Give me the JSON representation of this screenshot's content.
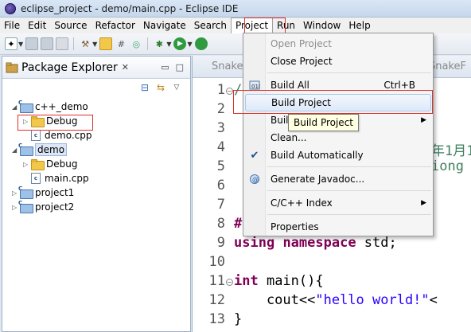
{
  "window": {
    "title": "eclipse_project - demo/main.cpp - Eclipse IDE"
  },
  "menubar": [
    "File",
    "Edit",
    "Source",
    "Refactor",
    "Navigate",
    "Search",
    "Project",
    "Run",
    "Window",
    "Help"
  ],
  "explorer": {
    "title": "Package Explorer",
    "tree": [
      {
        "label": "c++_demo",
        "type": "project",
        "expanded": true
      },
      {
        "label": "Debug",
        "type": "folder"
      },
      {
        "label": "demo.cpp",
        "type": "file"
      },
      {
        "label": "demo",
        "type": "project",
        "expanded": true
      },
      {
        "label": "Debug",
        "type": "folder"
      },
      {
        "label": "main.cpp",
        "type": "file"
      },
      {
        "label": "project1",
        "type": "project"
      },
      {
        "label": "project2",
        "type": "project"
      }
    ]
  },
  "editor": {
    "tabs": [
      "Snake",
      "SnakeF"
    ],
    "line_numbers": [
      "1",
      "2",
      "3",
      "4",
      "5",
      "6",
      "7",
      "8",
      "9",
      "10",
      "11",
      "12",
      "13"
    ],
    "visible_code": {
      "l4": "年1月1",
      "l5": "iong",
      "l8": "#",
      "l9_kw1": "using",
      "l9_kw2": "namespace",
      "l9_rest": " std;",
      "l11_kw": "int",
      "l11_rest": " main(){",
      "l12_pre": "    cout<<",
      "l12_str": "\"hello world!\"",
      "l12_post": "<",
      "l13": "}"
    }
  },
  "project_menu": {
    "items": [
      {
        "label": "Open Project",
        "disabled": true
      },
      {
        "label": "Close Project"
      },
      {
        "label": "Build All",
        "accel": "Ctrl+B"
      },
      {
        "label": "Build Project",
        "highlighted": true
      },
      {
        "label": "Buil",
        "submenu": true
      },
      {
        "label": "Clean..."
      },
      {
        "label": "Build Automatically",
        "checked": true
      },
      {
        "label": "Generate Javadoc..."
      },
      {
        "label": "C/C++ Index",
        "submenu": true
      },
      {
        "label": "Properties"
      }
    ],
    "tooltip": "Build Project",
    "check_glyph": "✔"
  },
  "colors": {
    "highlight_box": "#e0302a",
    "keyword": "#7f0055",
    "string": "#2a00ff"
  }
}
